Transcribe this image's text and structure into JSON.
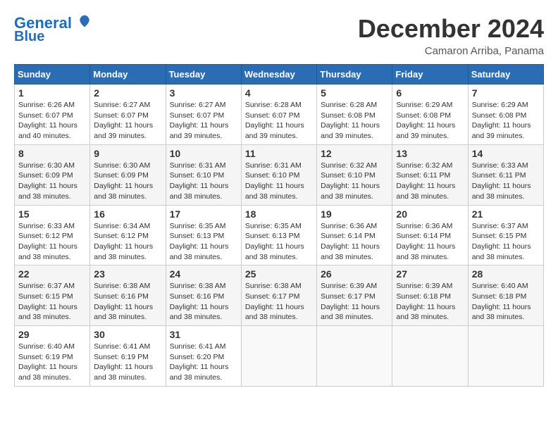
{
  "header": {
    "logo_line1": "General",
    "logo_line2": "Blue",
    "month": "December 2024",
    "location": "Camaron Arriba, Panama"
  },
  "calendar": {
    "days_of_week": [
      "Sunday",
      "Monday",
      "Tuesday",
      "Wednesday",
      "Thursday",
      "Friday",
      "Saturday"
    ],
    "weeks": [
      [
        {
          "day": "",
          "info": ""
        },
        {
          "day": "",
          "info": ""
        },
        {
          "day": "",
          "info": ""
        },
        {
          "day": "",
          "info": ""
        },
        {
          "day": "",
          "info": ""
        },
        {
          "day": "",
          "info": ""
        },
        {
          "day": "1",
          "info": "Sunrise: 6:29 AM\nSunset: 6:08 PM\nDaylight: 11 hours\nand 39 minutes."
        }
      ],
      [
        {
          "day": "1",
          "info": "Sunrise: 6:26 AM\nSunset: 6:07 PM\nDaylight: 11 hours\nand 40 minutes."
        },
        {
          "day": "2",
          "info": "Sunrise: 6:27 AM\nSunset: 6:07 PM\nDaylight: 11 hours\nand 39 minutes."
        },
        {
          "day": "3",
          "info": "Sunrise: 6:27 AM\nSunset: 6:07 PM\nDaylight: 11 hours\nand 39 minutes."
        },
        {
          "day": "4",
          "info": "Sunrise: 6:28 AM\nSunset: 6:07 PM\nDaylight: 11 hours\nand 39 minutes."
        },
        {
          "day": "5",
          "info": "Sunrise: 6:28 AM\nSunset: 6:08 PM\nDaylight: 11 hours\nand 39 minutes."
        },
        {
          "day": "6",
          "info": "Sunrise: 6:29 AM\nSunset: 6:08 PM\nDaylight: 11 hours\nand 39 minutes."
        },
        {
          "day": "7",
          "info": "Sunrise: 6:29 AM\nSunset: 6:08 PM\nDaylight: 11 hours\nand 39 minutes."
        }
      ],
      [
        {
          "day": "8",
          "info": "Sunrise: 6:30 AM\nSunset: 6:09 PM\nDaylight: 11 hours\nand 38 minutes."
        },
        {
          "day": "9",
          "info": "Sunrise: 6:30 AM\nSunset: 6:09 PM\nDaylight: 11 hours\nand 38 minutes."
        },
        {
          "day": "10",
          "info": "Sunrise: 6:31 AM\nSunset: 6:10 PM\nDaylight: 11 hours\nand 38 minutes."
        },
        {
          "day": "11",
          "info": "Sunrise: 6:31 AM\nSunset: 6:10 PM\nDaylight: 11 hours\nand 38 minutes."
        },
        {
          "day": "12",
          "info": "Sunrise: 6:32 AM\nSunset: 6:10 PM\nDaylight: 11 hours\nand 38 minutes."
        },
        {
          "day": "13",
          "info": "Sunrise: 6:32 AM\nSunset: 6:11 PM\nDaylight: 11 hours\nand 38 minutes."
        },
        {
          "day": "14",
          "info": "Sunrise: 6:33 AM\nSunset: 6:11 PM\nDaylight: 11 hours\nand 38 minutes."
        }
      ],
      [
        {
          "day": "15",
          "info": "Sunrise: 6:33 AM\nSunset: 6:12 PM\nDaylight: 11 hours\nand 38 minutes."
        },
        {
          "day": "16",
          "info": "Sunrise: 6:34 AM\nSunset: 6:12 PM\nDaylight: 11 hours\nand 38 minutes."
        },
        {
          "day": "17",
          "info": "Sunrise: 6:35 AM\nSunset: 6:13 PM\nDaylight: 11 hours\nand 38 minutes."
        },
        {
          "day": "18",
          "info": "Sunrise: 6:35 AM\nSunset: 6:13 PM\nDaylight: 11 hours\nand 38 minutes."
        },
        {
          "day": "19",
          "info": "Sunrise: 6:36 AM\nSunset: 6:14 PM\nDaylight: 11 hours\nand 38 minutes."
        },
        {
          "day": "20",
          "info": "Sunrise: 6:36 AM\nSunset: 6:14 PM\nDaylight: 11 hours\nand 38 minutes."
        },
        {
          "day": "21",
          "info": "Sunrise: 6:37 AM\nSunset: 6:15 PM\nDaylight: 11 hours\nand 38 minutes."
        }
      ],
      [
        {
          "day": "22",
          "info": "Sunrise: 6:37 AM\nSunset: 6:15 PM\nDaylight: 11 hours\nand 38 minutes."
        },
        {
          "day": "23",
          "info": "Sunrise: 6:38 AM\nSunset: 6:16 PM\nDaylight: 11 hours\nand 38 minutes."
        },
        {
          "day": "24",
          "info": "Sunrise: 6:38 AM\nSunset: 6:16 PM\nDaylight: 11 hours\nand 38 minutes."
        },
        {
          "day": "25",
          "info": "Sunrise: 6:38 AM\nSunset: 6:17 PM\nDaylight: 11 hours\nand 38 minutes."
        },
        {
          "day": "26",
          "info": "Sunrise: 6:39 AM\nSunset: 6:17 PM\nDaylight: 11 hours\nand 38 minutes."
        },
        {
          "day": "27",
          "info": "Sunrise: 6:39 AM\nSunset: 6:18 PM\nDaylight: 11 hours\nand 38 minutes."
        },
        {
          "day": "28",
          "info": "Sunrise: 6:40 AM\nSunset: 6:18 PM\nDaylight: 11 hours\nand 38 minutes."
        }
      ],
      [
        {
          "day": "29",
          "info": "Sunrise: 6:40 AM\nSunset: 6:19 PM\nDaylight: 11 hours\nand 38 minutes."
        },
        {
          "day": "30",
          "info": "Sunrise: 6:41 AM\nSunset: 6:19 PM\nDaylight: 11 hours\nand 38 minutes."
        },
        {
          "day": "31",
          "info": "Sunrise: 6:41 AM\nSunset: 6:20 PM\nDaylight: 11 hours\nand 38 minutes."
        },
        {
          "day": "",
          "info": ""
        },
        {
          "day": "",
          "info": ""
        },
        {
          "day": "",
          "info": ""
        },
        {
          "day": "",
          "info": ""
        }
      ]
    ]
  }
}
